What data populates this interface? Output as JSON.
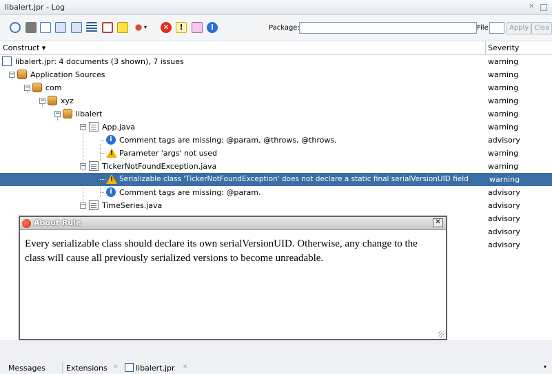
{
  "window": {
    "title": "libalert.jpr - Log"
  },
  "toolbar": {
    "icons": [
      "refresh-icon",
      "stop-icon",
      "export-icon",
      "expand-icon",
      "collapse-icon",
      "list-icon",
      "audit-icon",
      "note-icon",
      "bulb-icon",
      "error-filter-icon",
      "warning-filter-icon",
      "incomplete-filter-icon",
      "info-filter-icon"
    ],
    "package_label": "Package:",
    "package_value": "",
    "file_label": "File:",
    "file_value": "",
    "apply_label": "Apply",
    "clear_label": "Clea"
  },
  "columns": {
    "construct": "Construct ▾",
    "severity": "Severity"
  },
  "tree": {
    "rows": [
      {
        "label": "libalert.jpr: 4 documents (3 shown), 7 issues",
        "severity": "warning"
      },
      {
        "label": "Application Sources",
        "severity": "warning"
      },
      {
        "label": "com",
        "severity": "warning"
      },
      {
        "label": "xyz",
        "severity": "warning"
      },
      {
        "label": "libalert",
        "severity": "warning"
      },
      {
        "label": "App.java",
        "severity": "warning"
      },
      {
        "label": "Comment tags are missing: @param, @throws, @throws.",
        "severity": "advisory"
      },
      {
        "label": "Parameter 'args' not used",
        "severity": "warning"
      },
      {
        "label": "TickerNotFoundException.java",
        "severity": "warning"
      },
      {
        "label": "Serializable class 'TickerNotFoundException' does not declare a static final serialVersionUID field",
        "severity": "warning"
      },
      {
        "label": "Comment tags are missing: @param.",
        "severity": "advisory"
      },
      {
        "label": "TimeSeries.java",
        "severity": "advisory"
      },
      {
        "label": "",
        "severity": "advisory"
      },
      {
        "label": "",
        "severity": "advisory"
      },
      {
        "label": "",
        "severity": "advisory"
      }
    ]
  },
  "dialog": {
    "title": "About Rule",
    "close": "✕",
    "body": "Every serializable class should declare its own serialVersionUID. Otherwise, any change to the class will cause all previously serialized versions to become unreadable."
  },
  "bottom_tabs": {
    "messages": "Messages",
    "extensions": "Extensions",
    "libalert": "libalert.jpr"
  },
  "colors": {
    "selection": "#3a6ea5",
    "warning": "#f4b400",
    "info": "#2a6fd6",
    "error": "#d8321c"
  }
}
